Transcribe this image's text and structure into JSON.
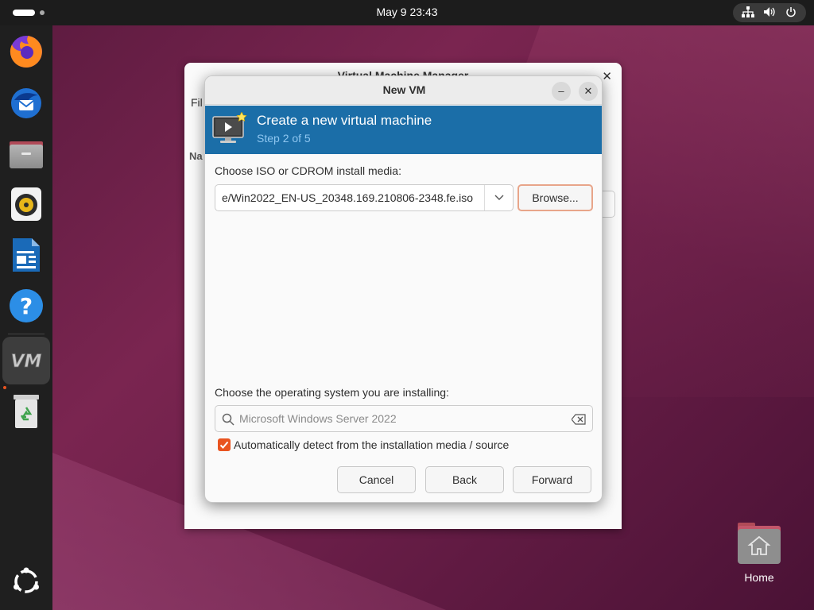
{
  "topbar": {
    "clock": "May 9  23:43",
    "tray_icons": [
      "network-icon",
      "volume-icon",
      "power-icon"
    ]
  },
  "dock": {
    "items": [
      {
        "name": "firefox",
        "icon": "firefox-icon"
      },
      {
        "name": "thunderbird",
        "icon": "thunderbird-icon"
      },
      {
        "name": "files",
        "icon": "files-icon"
      },
      {
        "name": "rhythmbox",
        "icon": "rhythmbox-icon"
      },
      {
        "name": "libreoffice-writer",
        "icon": "writer-icon"
      },
      {
        "name": "help",
        "icon": "help-icon"
      },
      {
        "name": "virt-manager",
        "icon": "virt-manager-icon",
        "label": "VM",
        "running": true
      },
      {
        "name": "trash",
        "icon": "trash-icon"
      }
    ],
    "apps_grid_icon": "ubuntu-icon"
  },
  "background_window": {
    "title": "Virtual Machine Manager",
    "menu_label": "Fil",
    "column_label": "Na"
  },
  "dialog": {
    "title": "New VM",
    "minimize_label": "–",
    "close_label": "✕",
    "banner": {
      "title": "Create a new virtual machine",
      "step": "Step 2 of 5"
    },
    "media_label": "Choose ISO or CDROM install media:",
    "media_value": "e/Win2022_EN-US_20348.169.210806-2348.fe.iso",
    "browse_label": "Browse...",
    "os_label": "Choose the operating system you are installing:",
    "os_placeholder": "Microsoft Windows Server 2022",
    "auto_detect_label": "Automatically detect from the installation media / source",
    "auto_detect_checked": true,
    "buttons": {
      "cancel": "Cancel",
      "back": "Back",
      "forward": "Forward"
    }
  },
  "desktop": {
    "home_label": "Home"
  },
  "colors": {
    "accent": "#e95420",
    "banner": "#1b6ea8",
    "step_text": "#8ec6f0"
  }
}
